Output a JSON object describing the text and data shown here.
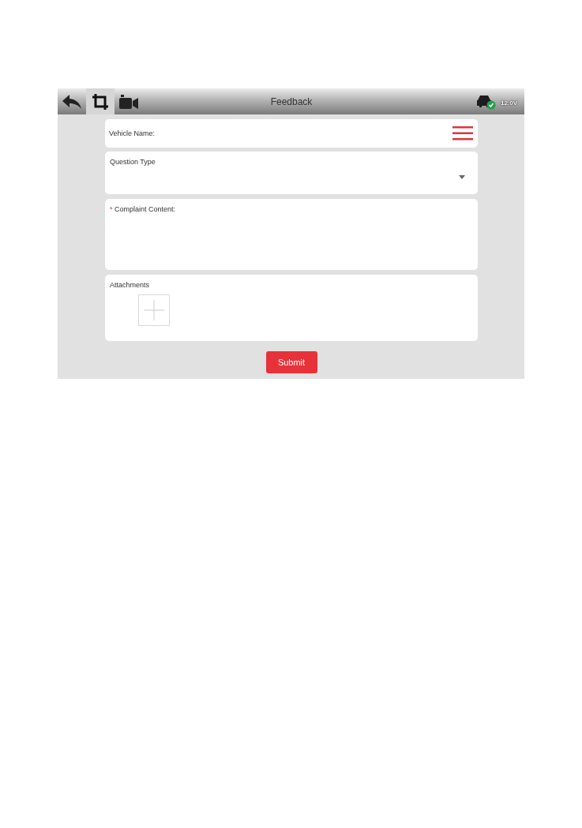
{
  "header": {
    "title": "Feedback",
    "voltage": "12.0V",
    "tools": [
      {
        "kind": "back",
        "selected": false
      },
      {
        "kind": "crop",
        "selected": true
      },
      {
        "kind": "video",
        "selected": false
      }
    ]
  },
  "fields": [
    {
      "kind": "text",
      "label": "Vehicle Name:",
      "required": false
    },
    {
      "kind": "select",
      "label": "Question Type",
      "required": false
    },
    {
      "kind": "textarea",
      "label": "Complaint Content:",
      "required": true
    },
    {
      "kind": "attachments",
      "label": "Attachments",
      "required": false
    }
  ],
  "required_mark": "*",
  "submit": "Submit"
}
